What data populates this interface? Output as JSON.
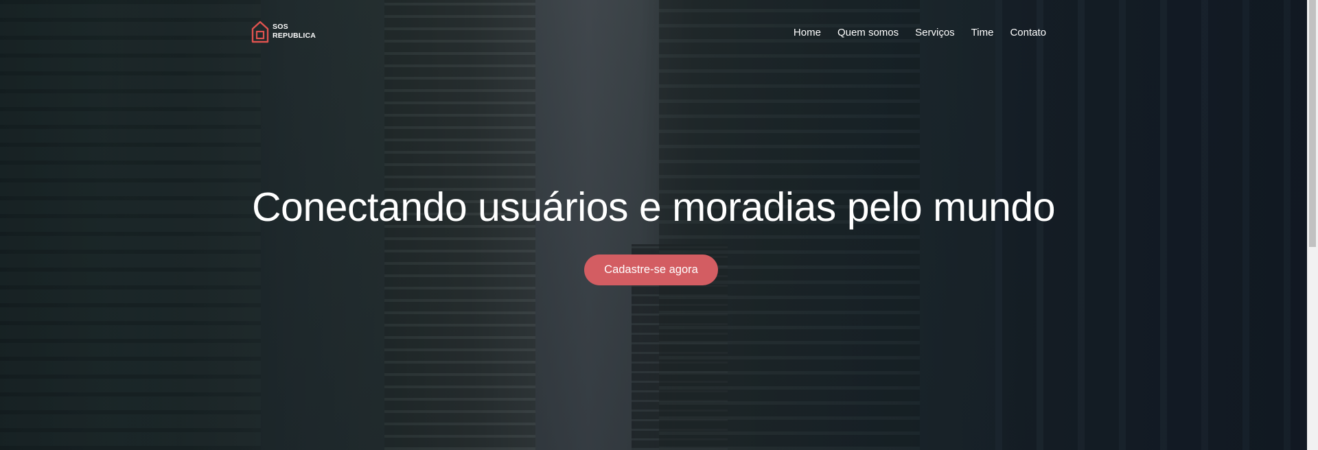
{
  "brand": {
    "logo_line1": "SOS",
    "logo_line2": "REPUBLICA",
    "icon": "house-icon",
    "accent_color": "#d35d62"
  },
  "nav": {
    "items": [
      {
        "label": "Home"
      },
      {
        "label": "Quem somos"
      },
      {
        "label": "Serviços"
      },
      {
        "label": "Time"
      },
      {
        "label": "Contato"
      }
    ]
  },
  "hero": {
    "headline": "Conectando usuários e moradias pelo mundo",
    "cta_label": "Cadastre-se agora",
    "background": "city-buildings-photo"
  }
}
